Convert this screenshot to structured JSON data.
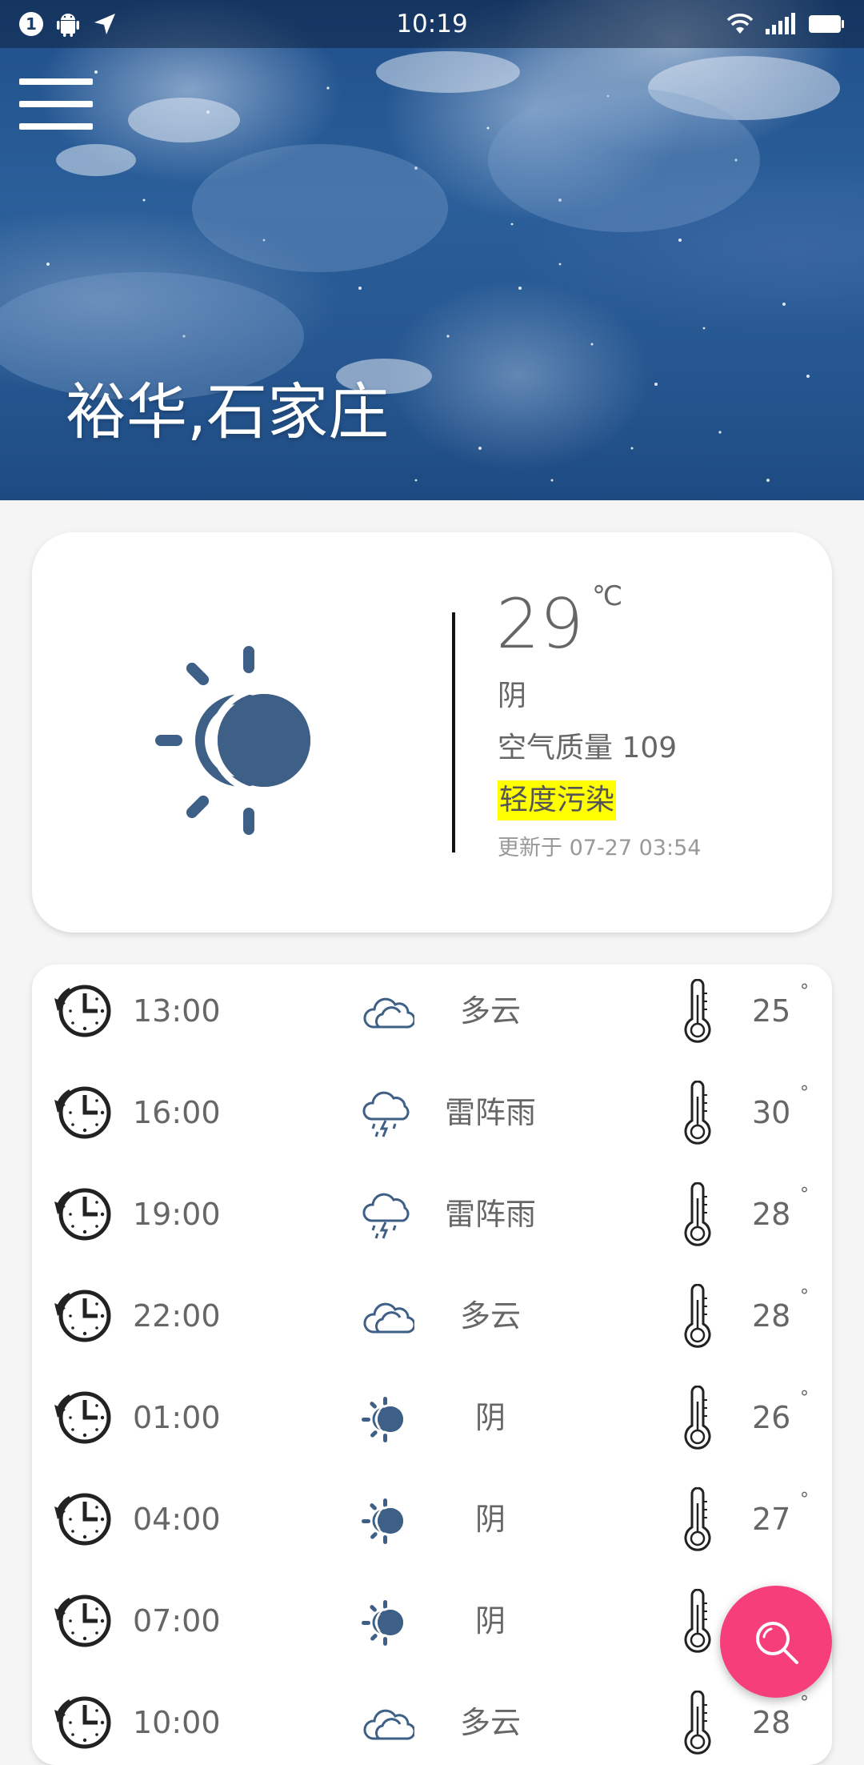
{
  "status_bar": {
    "notification_count": "1",
    "time": "10:19",
    "icons": [
      "android-icon",
      "location-arrow-icon",
      "wifi-icon",
      "signal-icon",
      "battery-icon"
    ]
  },
  "header": {
    "location": "裕华,石家庄"
  },
  "current": {
    "temperature": "29",
    "unit": "℃",
    "condition": "阴",
    "air_quality_label": "空气质量",
    "air_quality_value": "109",
    "pollution_level": "轻度污染",
    "pollution_color": "#ffff00",
    "updated_text": "更新于 07-27 03:54",
    "icon": "sun-cloud-icon"
  },
  "forecast": [
    {
      "time": "13:00",
      "condition": "多云",
      "icon": "cloudy-icon",
      "temp": "25",
      "degree": "°"
    },
    {
      "time": "16:00",
      "condition": "雷阵雨",
      "icon": "thunderstorm-icon",
      "temp": "30",
      "degree": "°"
    },
    {
      "time": "19:00",
      "condition": "雷阵雨",
      "icon": "thunderstorm-icon",
      "temp": "28",
      "degree": "°"
    },
    {
      "time": "22:00",
      "condition": "多云",
      "icon": "cloudy-icon",
      "temp": "28",
      "degree": "°"
    },
    {
      "time": "01:00",
      "condition": "阴",
      "icon": "overcast-icon",
      "temp": "26",
      "degree": "°"
    },
    {
      "time": "04:00",
      "condition": "阴",
      "icon": "overcast-icon",
      "temp": "27",
      "degree": "°"
    },
    {
      "time": "07:00",
      "condition": "阴",
      "icon": "overcast-icon",
      "temp": "",
      "degree": ""
    },
    {
      "time": "10:00",
      "condition": "多云",
      "icon": "cloudy-icon",
      "temp": "28",
      "degree": "°"
    }
  ],
  "colors": {
    "accent": "#f63f7a",
    "icon_blue": "#3e5f86",
    "text_gray": "#666666"
  }
}
